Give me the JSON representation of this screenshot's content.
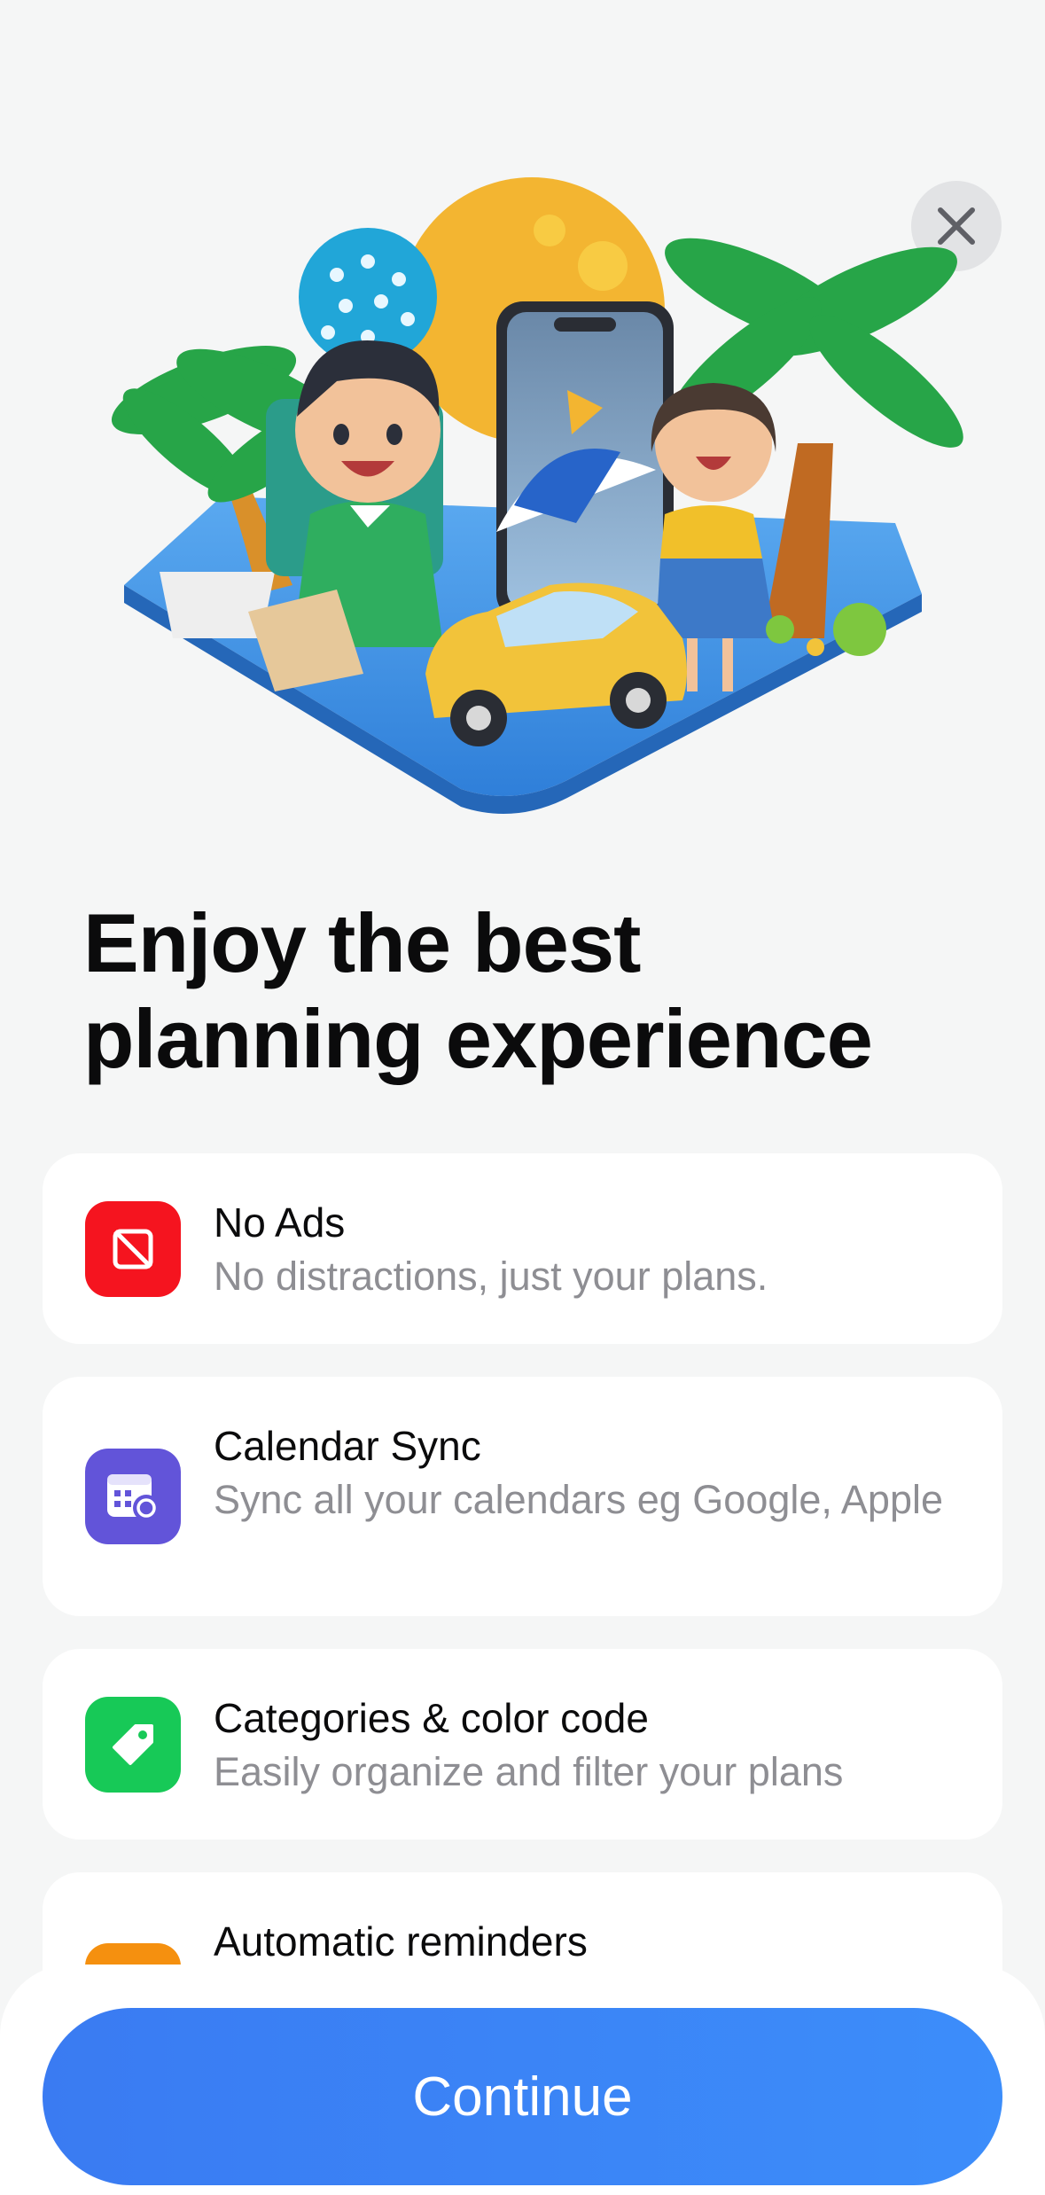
{
  "header": {
    "title": "Enjoy the best\nplanning experience",
    "close_icon": "close-icon"
  },
  "features": [
    {
      "icon": "no-ads-icon",
      "color": "#f5141f",
      "title": "No Ads",
      "description": "No distractions, just your plans."
    },
    {
      "icon": "calendar-sync-icon",
      "color": "#6254d9",
      "title": "Calendar Sync",
      "description": "Sync all your calendars eg Google, Apple"
    },
    {
      "icon": "tag-icon",
      "color": "#17c957",
      "title": "Categories & color code",
      "description": "Easily organize and filter your plans"
    },
    {
      "icon": "bell-icon",
      "color": "#f5900f",
      "title": "Automatic reminders",
      "description": ""
    }
  ],
  "footer": {
    "continue_label": "Continue"
  },
  "colors": {
    "accent": "#3b82f6",
    "background": "#f5f6f6"
  }
}
